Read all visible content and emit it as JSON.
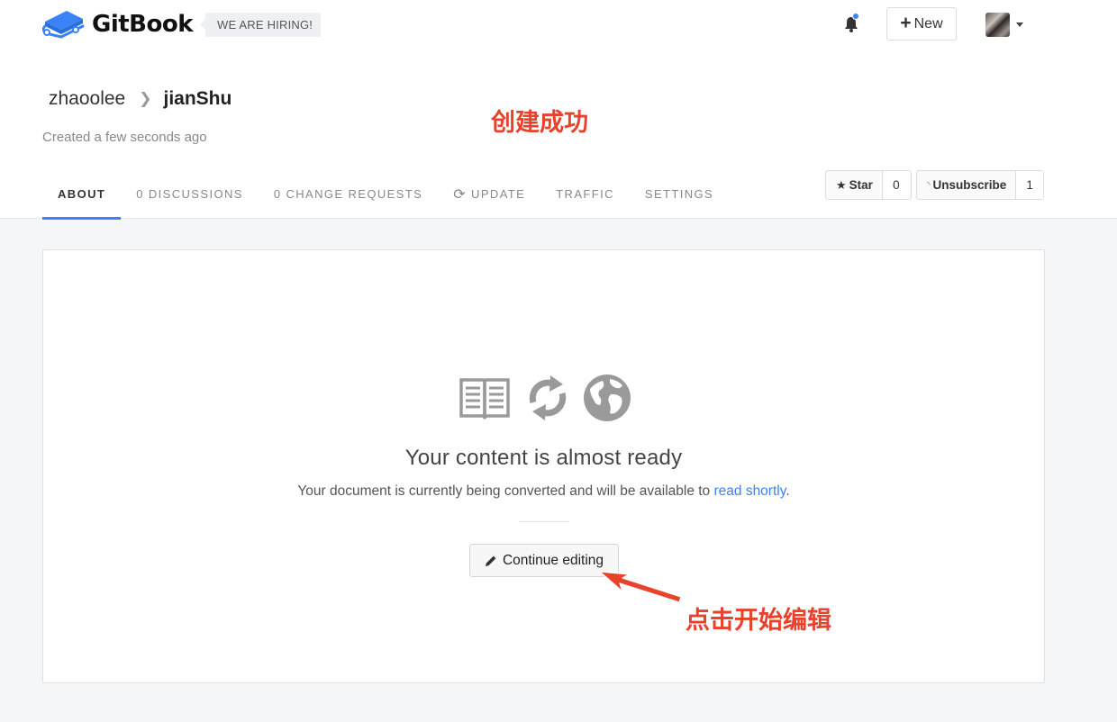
{
  "header": {
    "logo_text": "GitBook",
    "hiring_badge": "WE ARE HIRING!",
    "new_button_label": "New",
    "notification_dot_color": "#3a82f7"
  },
  "breadcrumb": {
    "owner": "zhaoolee",
    "book": "jianShu"
  },
  "created_text": "Created a few seconds ago",
  "annotations": {
    "success": "创建成功",
    "click_to_edit": "点击开始编辑"
  },
  "tabs": [
    {
      "label": "ABOUT",
      "active": true
    },
    {
      "label": "0 DISCUSSIONS",
      "active": false
    },
    {
      "label": "0 CHANGE REQUESTS",
      "active": false
    },
    {
      "label": "UPDATE",
      "active": false,
      "icon": "sync-icon"
    },
    {
      "label": "TRAFFIC",
      "active": false
    },
    {
      "label": "SETTINGS",
      "active": false
    }
  ],
  "social": {
    "star_label": "Star",
    "star_count": "0",
    "unsubscribe_label": "Unsubscribe",
    "subscriber_count": "1"
  },
  "card": {
    "title": "Your content is almost ready",
    "text_before_link": "Your document is currently being converted and will be available to ",
    "link_text": "read shortly",
    "text_after_link": ".",
    "button_label": "Continue editing",
    "icons": [
      "book-icon",
      "sync-icon",
      "globe-icon"
    ]
  },
  "colors": {
    "accent": "#3a82f7",
    "annotation": "#e8412c"
  }
}
